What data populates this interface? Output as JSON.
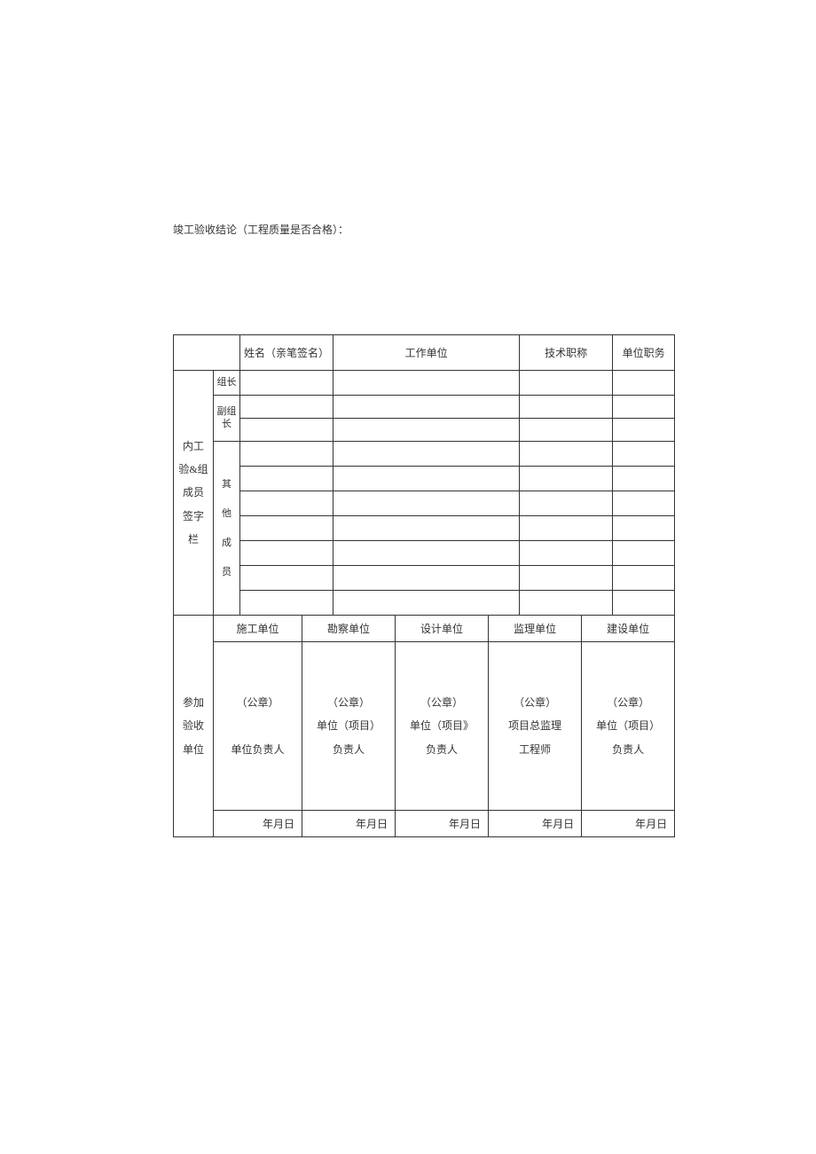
{
  "title": "竣工验收结论（工程质量是否合格）：",
  "headers": {
    "name": "姓名（亲笔签名）",
    "work_unit": "工作单位",
    "tech_title": "技术职称",
    "position": "单位职务"
  },
  "left_label": "内工验&组成员签字栏",
  "roles": {
    "leader": "组长",
    "deputy": "副组长",
    "others_line1": "其",
    "others_line2": "他",
    "others_line3": "成",
    "others_line4": "员"
  },
  "units_section_label": "参加验收单位",
  "units": {
    "construction": "施工单位",
    "survey": "勘察单位",
    "design": "设计单位",
    "supervision": "监理单位",
    "build": "建设单位"
  },
  "seal": "（公章）",
  "person": {
    "construction": "单位负责人",
    "survey_line1": "单位（项目）",
    "survey_line2": "负责人",
    "design_line1": "单位（项目》",
    "design_line2": "负责人",
    "supervision_line1": "项目总监理",
    "supervision_line2": "工程师",
    "build_line1": "单位（项目）",
    "build_line2": "负责人"
  },
  "date": "年月日"
}
